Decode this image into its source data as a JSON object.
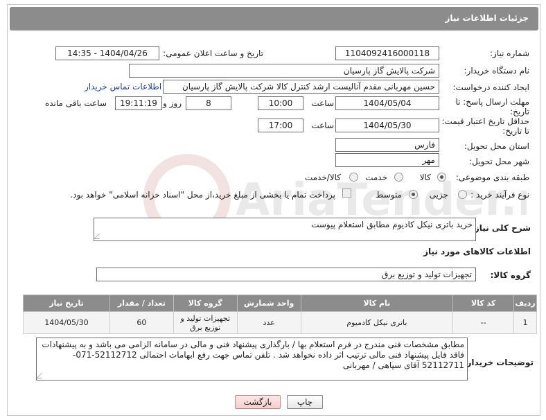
{
  "header": {
    "title": "جزئیات اطلاعات نیاز"
  },
  "fields": {
    "need_number_label": "شماره نیاز:",
    "need_number": "1104092416000118",
    "announce_label": "تاریخ و ساعت اعلان عمومی:",
    "announce_value": "1404/04/26 - 14:35",
    "buyer_org_label": "نام دستگاه خریدار:",
    "buyer_org": "شرکت پالایش گاز پارسیان",
    "creator_label": "ایجاد کننده درخواست:",
    "creator": "حسین مهربانی مقدم آنالیست ارشد کنترل کالا  شرکت پالایش گاز پارسیان",
    "buyer_contact_link": "اطلاعات تماس خریدار",
    "deadline_label_1": "مهلت ارسال پاسخ: تا",
    "deadline_label_2": "تاریخ:",
    "deadline_date": "1404/05/04",
    "time_label": "ساعت",
    "deadline_time": "10:00",
    "days_value": "8",
    "days_label": "روز و",
    "remaining_time": "19:11:19",
    "remaining_label": "ساعت باقی مانده",
    "min_price_label_1": "حداقل تاریخ اعتبار قیمت:",
    "min_price_label_2": "تا تاریخ:",
    "min_price_date": "1404/05/30",
    "min_price_time": "17:00",
    "province_label": "استان محل تحویل:",
    "province": "فارس",
    "city_label": "شهر محل تحویل:",
    "city": "مهر",
    "category_label": "طبقه بندی موضوعی:",
    "category_options": [
      "کالا",
      "خدمت",
      "کالا/خدمت"
    ],
    "process_label": "نوع فرآیند خرید :",
    "process_options": [
      "جزیی",
      "متوسط"
    ],
    "payment_note": "پرداخت تمام یا بخشی از مبلغ خرید،از محل \"اسناد خزانه اسلامی\" خواهد بود."
  },
  "description": {
    "label": "شرح کلی نیاز:",
    "value": "خرید باتری نیکل کادیوم مطابق استعلام پیوست"
  },
  "goods_section": {
    "title": "اطلاعات کالاهای مورد نیاز",
    "group_label": "گروه کالا:",
    "group_value": "تجهیزات تولید و توزیع برق"
  },
  "table": {
    "headers": [
      "ردیف",
      "کد کالا",
      "نام کالا",
      "واحد شمارش",
      "گروه کالا",
      "تعداد / مقدار",
      "تاریخ نیاز"
    ],
    "rows": [
      [
        "1",
        "--",
        "باتری نیکل کادمیوم",
        "عدد",
        "تجهیزات تولید و توزیع برق",
        "60",
        "1404/05/30"
      ]
    ]
  },
  "buyer_notes": {
    "label": "توضیحات خریدار:",
    "value": "مطابق مشخصات فنی مندرج در فرم استعلام بها / بارگذاری پیشنهاد فنی و مالی در سامانه الزامی می باشد و به پیشنهادات فاقد فایل پیشنهاد فنی مالی ترتیب اثر داده نخواهد شد . تلفن تماس جهت رفع ابهامات احتمالی 52112712-071-52112711 آقای سپاهی / مهربانی"
  },
  "buttons": {
    "print": "چاپ",
    "back": "بازگشت"
  },
  "watermark": "AriaTender.neT",
  "colors": {
    "header_bg": "#8c8c8c",
    "link": "#1a3ea8"
  }
}
